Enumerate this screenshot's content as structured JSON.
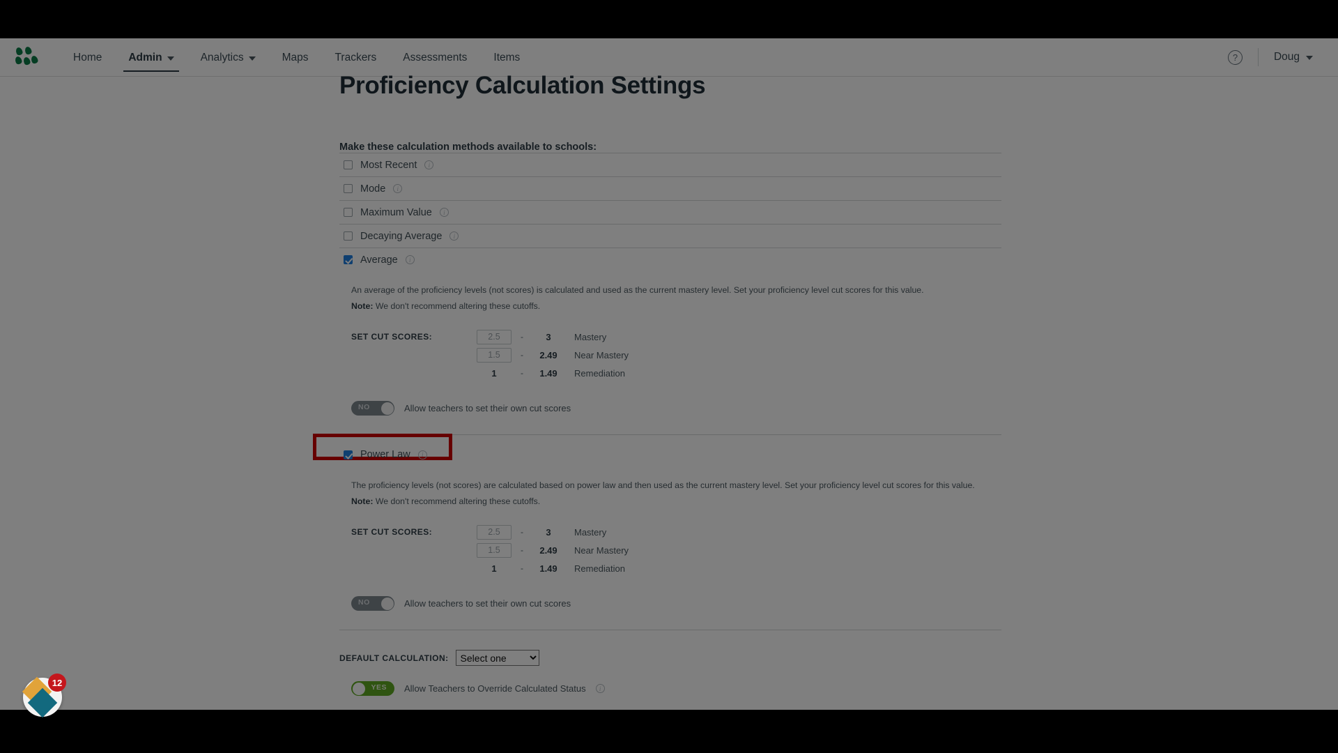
{
  "nav": {
    "logo_name": "mastery-connect-logo",
    "items": [
      {
        "label": "Home",
        "has_caret": false,
        "active": false
      },
      {
        "label": "Admin",
        "has_caret": true,
        "active": true
      },
      {
        "label": "Analytics",
        "has_caret": true,
        "active": false
      },
      {
        "label": "Maps",
        "has_caret": false,
        "active": false
      },
      {
        "label": "Trackers",
        "has_caret": false,
        "active": false
      },
      {
        "label": "Assessments",
        "has_caret": false,
        "active": false
      },
      {
        "label": "Items",
        "has_caret": false,
        "active": false
      }
    ],
    "help_label": "?",
    "user_name": "Doug"
  },
  "page": {
    "title": "Proficiency Calculation Settings",
    "subhead": "Make these calculation methods available to schools:"
  },
  "methods": [
    {
      "label": "Most Recent",
      "checked": false
    },
    {
      "label": "Mode",
      "checked": false
    },
    {
      "label": "Maximum Value",
      "checked": false
    },
    {
      "label": "Decaying Average",
      "checked": false
    }
  ],
  "average_section": {
    "label": "Average",
    "checked": true,
    "description": "An average of the proficiency levels (not scores) is calculated and used as the current mastery level. Set your proficiency level cut scores for this value.",
    "note_prefix": "Note:",
    "note_text": "We don't recommend altering these cutoffs.",
    "cut_scores_label": "SET CUT SCORES:",
    "rows": [
      {
        "min": "2.5",
        "min_editable": true,
        "dash": "-",
        "max": "3",
        "name": "Mastery"
      },
      {
        "min": "1.5",
        "min_editable": true,
        "dash": "-",
        "max": "2.49",
        "name": "Near Mastery"
      },
      {
        "min": "1",
        "min_editable": false,
        "dash": "-",
        "max": "1.49",
        "name": "Remediation"
      }
    ],
    "toggle_value": "NO",
    "toggle_on": false,
    "toggle_text": "Allow teachers to set their own cut scores"
  },
  "powerlaw_section": {
    "label": "Power Law",
    "checked": true,
    "highlighted": true,
    "highlight_color": "#cc0000",
    "description": "The proficiency levels (not scores) are calculated based on power law and then used as the current mastery level. Set your proficiency level cut scores for this value.",
    "note_prefix": "Note:",
    "note_text": "We don't recommend altering these cutoffs.",
    "cut_scores_label": "SET CUT SCORES:",
    "rows": [
      {
        "min": "2.5",
        "min_editable": true,
        "dash": "-",
        "max": "3",
        "name": "Mastery"
      },
      {
        "min": "1.5",
        "min_editable": true,
        "dash": "-",
        "max": "2.49",
        "name": "Near Mastery"
      },
      {
        "min": "1",
        "min_editable": false,
        "dash": "-",
        "max": "1.49",
        "name": "Remediation"
      }
    ],
    "toggle_value": "NO",
    "toggle_on": false,
    "toggle_text": "Allow teachers to set their own cut scores"
  },
  "footer": {
    "default_calculation_label": "DEFAULT CALCULATION:",
    "default_calculation_value": "Select one",
    "default_calculation_options": [
      "Select one"
    ],
    "override_toggle_value": "YES",
    "override_toggle_on": true,
    "override_toggle_text": "Allow Teachers to Override Calculated Status"
  },
  "fab": {
    "badge_count": "12",
    "name": "notifications-widget"
  }
}
